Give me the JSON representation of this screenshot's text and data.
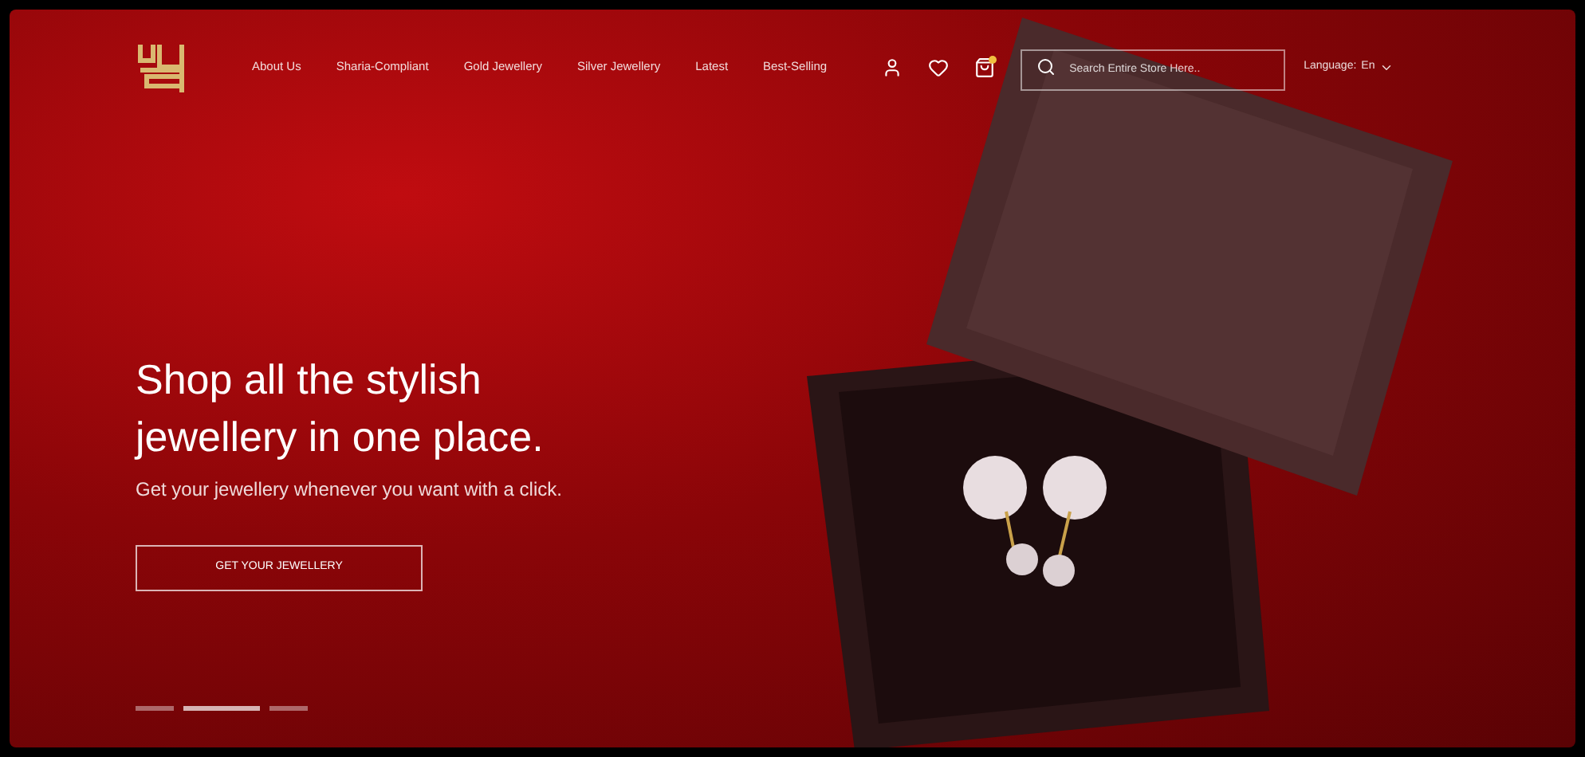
{
  "nav": {
    "links": [
      "About Us",
      "Sharia-Compliant",
      "Gold Jewellery",
      "Silver Jewellery",
      "Latest",
      "Best-Selling"
    ],
    "cart_badge": true,
    "search": {
      "placeholder": "Search Entire Store Here.."
    },
    "language": {
      "label": "Language:",
      "value": "En"
    }
  },
  "hero": {
    "title": "Shop all the stylish jewellery in one place.",
    "subtitle": "Get your jewellery whenever you want with a click.",
    "button": "GET YOUR JEWELLERY"
  },
  "slides": [
    {
      "selected": false
    },
    {
      "selected": true
    },
    {
      "selected": false
    }
  ]
}
